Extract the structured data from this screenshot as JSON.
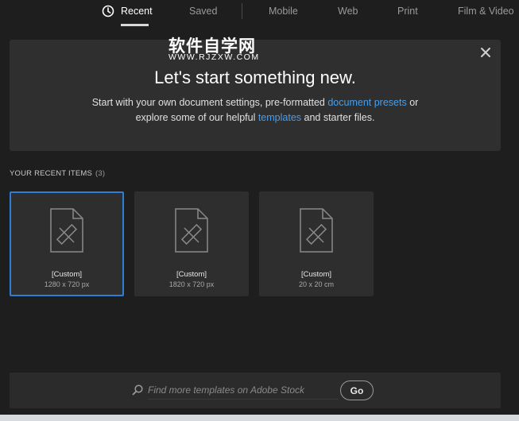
{
  "watermark": {
    "chinese": "软件自学网",
    "url": "WWW.RJZXW.COM"
  },
  "tabs": [
    {
      "label": "Recent",
      "active": true,
      "icon": "clock-icon"
    },
    {
      "label": "Saved",
      "active": false
    },
    {
      "label": "Mobile",
      "active": false
    },
    {
      "label": "Web",
      "active": false
    },
    {
      "label": "Print",
      "active": false
    },
    {
      "label": "Film & Video",
      "active": false
    }
  ],
  "hero": {
    "title": "Let's start something new.",
    "line1_before": "Start with your own document settings, pre-formatted ",
    "line1_link": "document presets",
    "line1_after": " or",
    "line2_before": "explore some of our helpful ",
    "line2_link": "templates",
    "line2_after": " and starter files.",
    "close_icon": "close-icon"
  },
  "recent": {
    "heading": "YOUR RECENT ITEMS",
    "count": "(3)",
    "items": [
      {
        "title": "[Custom]",
        "size": "1280 x 720 px",
        "selected": true,
        "icon": "document-pencil-icon"
      },
      {
        "title": "[Custom]",
        "size": "1820 x 720 px",
        "selected": false,
        "icon": "document-pencil-icon"
      },
      {
        "title": "[Custom]",
        "size": "20 x 20 cm",
        "selected": false,
        "icon": "document-pencil-icon"
      }
    ]
  },
  "search": {
    "placeholder": "Find more templates on Adobe Stock",
    "value": "",
    "button_label": "Go",
    "icon": "search-icon"
  },
  "colors": {
    "background": "#1e1e1e",
    "panel": "#2f2f2f",
    "accent_link": "#4a9ee8",
    "selected_border": "#2e7dd6"
  }
}
